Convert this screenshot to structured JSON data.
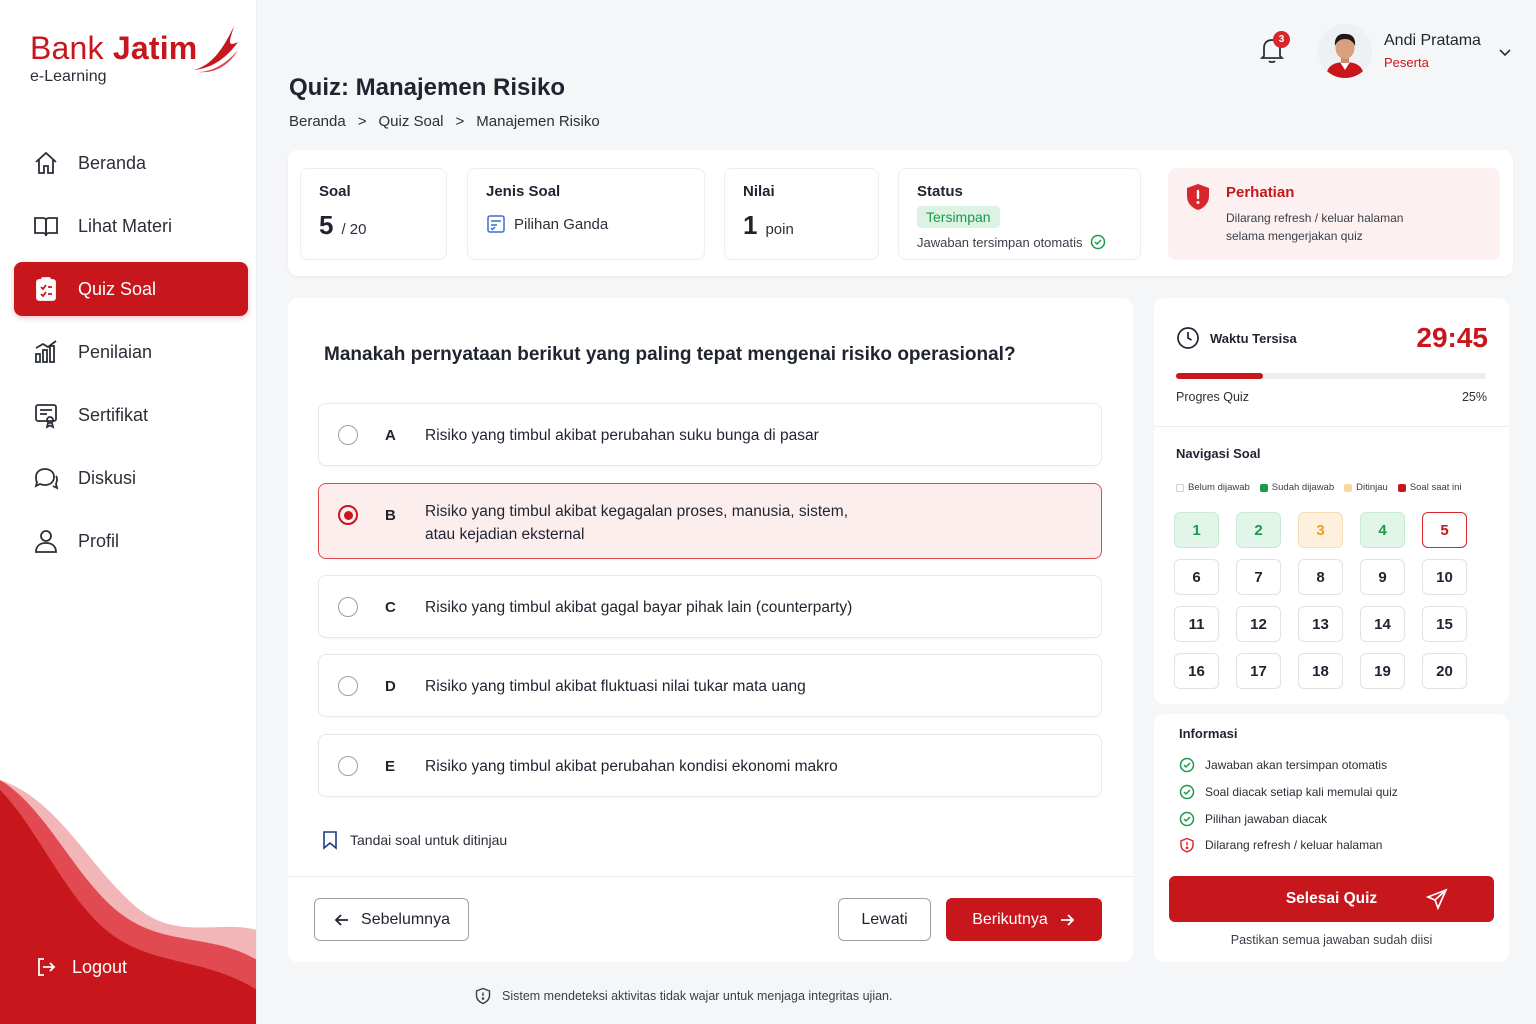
{
  "brand": {
    "name_part1": "Bank",
    "name_part2": "Jatim",
    "subtitle": "e-Learning",
    "brand_color": "#c8161d"
  },
  "sidebar": {
    "items": [
      {
        "label": "Beranda",
        "icon": "home-icon",
        "active": false
      },
      {
        "label": "Lihat Materi",
        "icon": "book-icon",
        "active": false
      },
      {
        "label": "Quiz Soal",
        "icon": "quiz-clipboard-icon",
        "active": true
      },
      {
        "label": "Penilaian",
        "icon": "bar-chart-icon",
        "active": false
      },
      {
        "label": "Sertifikat",
        "icon": "certificate-icon",
        "active": false
      },
      {
        "label": "Diskusi",
        "icon": "chat-icon",
        "active": false
      },
      {
        "label": "Profil",
        "icon": "user-icon",
        "active": false
      }
    ],
    "logout_label": "Logout"
  },
  "header": {
    "notification_count": "3",
    "user_name": "Andi Pratama",
    "user_role": "Peserta"
  },
  "page": {
    "title": "Quiz: Manajemen Risiko",
    "breadcrumb": [
      "Beranda",
      "Quiz Soal",
      "Manajemen Risiko"
    ],
    "breadcrumb_sep": ">"
  },
  "stats": {
    "soal_label": "Soal",
    "soal_current": "5",
    "soal_total": "/ 20",
    "jenis_label": "Jenis Soal",
    "jenis_value": "Pilihan Ganda",
    "nilai_label": "Nilai",
    "nilai_value": "1",
    "nilai_unit": "poin",
    "status_label": "Status",
    "status_value": "Tersimpan",
    "status_note": "Jawaban tersimpan otomatis"
  },
  "warning": {
    "title": "Perhatian",
    "line1": "Dilarang refresh / keluar halaman",
    "line2": "selama mengerjakan quiz"
  },
  "question": {
    "text": "Manakah pernyataan berikut yang paling tepat mengenai risiko operasional?",
    "options": [
      {
        "letter": "A",
        "line1": "Risiko yang timbul akibat perubahan suku bunga di pasar",
        "line2": "",
        "selected": false
      },
      {
        "letter": "B",
        "line1": "Risiko yang timbul akibat kegagalan proses, manusia, sistem,",
        "line2": "atau kejadian eksternal",
        "selected": true
      },
      {
        "letter": "C",
        "line1": "Risiko yang timbul akibat gagal bayar pihak lain (counterparty)",
        "line2": "",
        "selected": false
      },
      {
        "letter": "D",
        "line1": "Risiko yang timbul akibat fluktuasi nilai tukar mata uang",
        "line2": "",
        "selected": false
      },
      {
        "letter": "E",
        "line1": "Risiko yang timbul akibat perubahan kondisi ekonomi makro",
        "line2": "",
        "selected": false
      }
    ],
    "flag_label": "Tandai soal untuk ditinjau",
    "prev_label": "Sebelumnya",
    "skip_label": "Lewati",
    "next_label": "Berikutnya"
  },
  "timer": {
    "label": "Waktu Tersisa",
    "value": "29:45",
    "progress_label": "Progres Quiz",
    "progress_pct_text": "25%",
    "progress_fraction": 0.28
  },
  "navigation": {
    "title": "Navigasi Soal",
    "legend": [
      {
        "label": "Belum dijawab",
        "color": "#ffffff"
      },
      {
        "label": "Sudah dijawab",
        "color": "#1a9a4b"
      },
      {
        "label": "Ditinjau",
        "color": "#f6d7a0"
      },
      {
        "label": "Soal saat ini",
        "color": "#c8161d"
      }
    ],
    "questions": [
      {
        "n": "1",
        "state": "answered"
      },
      {
        "n": "2",
        "state": "answered"
      },
      {
        "n": "3",
        "state": "review"
      },
      {
        "n": "4",
        "state": "answered"
      },
      {
        "n": "5",
        "state": "current"
      },
      {
        "n": "6",
        "state": "unanswered"
      },
      {
        "n": "7",
        "state": "unanswered"
      },
      {
        "n": "8",
        "state": "unanswered"
      },
      {
        "n": "9",
        "state": "unanswered"
      },
      {
        "n": "10",
        "state": "unanswered"
      },
      {
        "n": "11",
        "state": "unanswered"
      },
      {
        "n": "12",
        "state": "unanswered"
      },
      {
        "n": "13",
        "state": "unanswered"
      },
      {
        "n": "14",
        "state": "unanswered"
      },
      {
        "n": "15",
        "state": "unanswered"
      },
      {
        "n": "16",
        "state": "unanswered"
      },
      {
        "n": "17",
        "state": "unanswered"
      },
      {
        "n": "18",
        "state": "unanswered"
      },
      {
        "n": "19",
        "state": "unanswered"
      },
      {
        "n": "20",
        "state": "unanswered"
      }
    ]
  },
  "info": {
    "title": "Informasi",
    "items": [
      {
        "text": "Jawaban akan tersimpan otomatis",
        "icon": "check-circle-icon"
      },
      {
        "text": "Soal diacak setiap kali memulai quiz",
        "icon": "check-circle-icon"
      },
      {
        "text": "Pilihan jawaban diacak",
        "icon": "check-circle-icon"
      },
      {
        "text": "Dilarang refresh / keluar halaman",
        "icon": "shield-alert-icon"
      }
    ],
    "finish_label": "Selesai Quiz",
    "finish_note": "Pastikan semua jawaban sudah diisi"
  },
  "footer": {
    "note": "Sistem mendeteksi aktivitas tidak wajar untuk menjaga integritas ujian."
  }
}
